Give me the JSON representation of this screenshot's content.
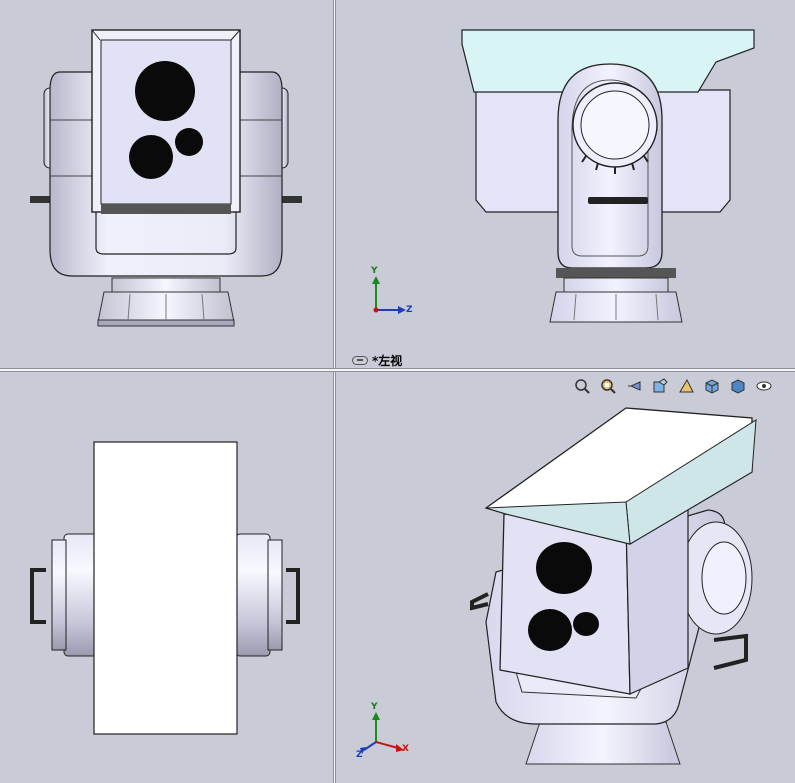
{
  "viewports": {
    "front": {
      "name": "front-view"
    },
    "left": {
      "name": "left-view",
      "label": "*左视",
      "active": true
    },
    "top": {
      "name": "top-view"
    },
    "iso": {
      "name": "isometric-view"
    }
  },
  "triad": {
    "left_view": {
      "y": "Y",
      "z": "Z"
    },
    "iso_view": {
      "y": "Y",
      "x": "X",
      "z": "Z"
    }
  },
  "heads_up_toolbar": [
    "zoom-to-fit-icon",
    "zoom-to-area-icon",
    "previous-view-icon",
    "section-view-icon",
    "dynamic-annotation-icon",
    "view-orientation-icon",
    "display-style-icon",
    "hide-show-items-icon"
  ],
  "colors": {
    "background": "#c9cbd6",
    "part_body": "#e6e6f8",
    "sunshade": "#d8f4f4",
    "edge": "#222222",
    "lens": "#0a0a0a"
  }
}
